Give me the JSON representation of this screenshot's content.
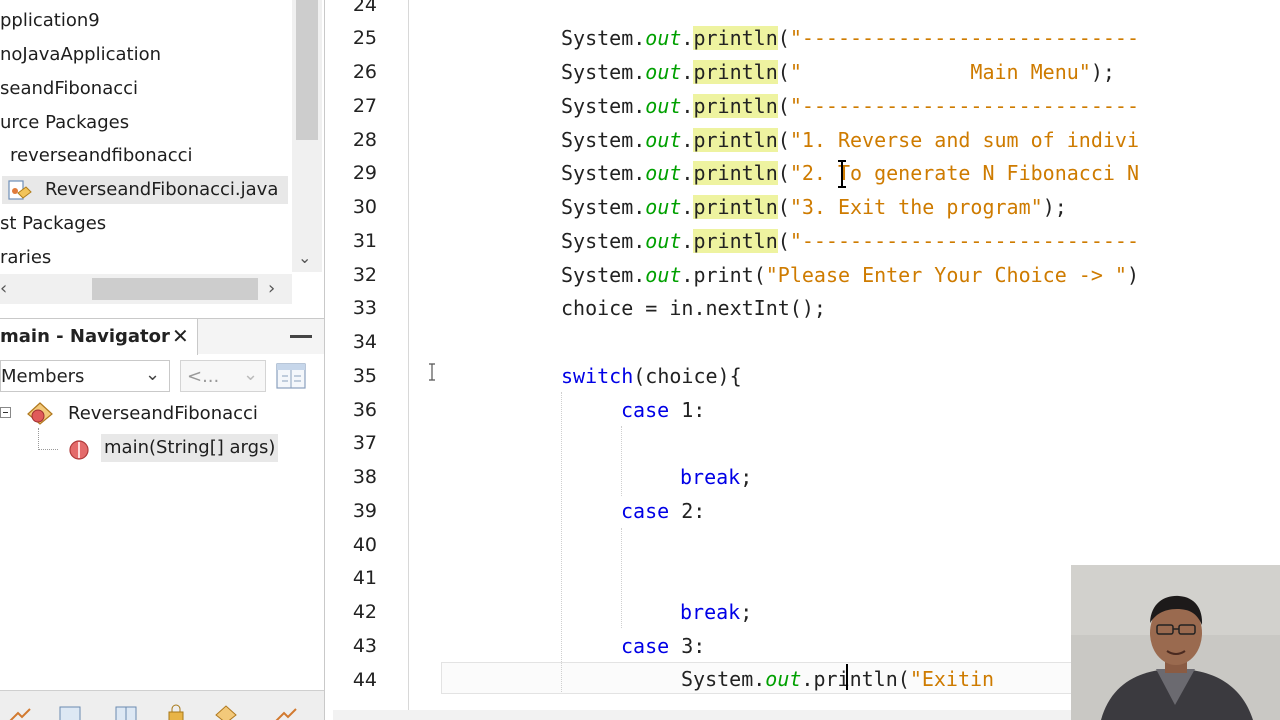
{
  "projects": {
    "items": [
      {
        "label": "pplication9"
      },
      {
        "label": "noJavaApplication"
      },
      {
        "label": "seandFibonacci"
      },
      {
        "label": "urce Packages"
      },
      {
        "label": "reverseandfibonacci"
      },
      {
        "label": "ReverseandFibonacci.java"
      },
      {
        "label": "st Packages"
      },
      {
        "label": "raries"
      }
    ]
  },
  "navigator": {
    "tab_label": "main - Navigator",
    "close_glyph": "✕",
    "members_label": "Members",
    "history_label": "<...",
    "class_label": "ReverseandFibonacci",
    "method_label": "main(String[] args)"
  },
  "editor": {
    "line_numbers": [
      "24",
      "25",
      "26",
      "27",
      "28",
      "29",
      "30",
      "31",
      "32",
      "33",
      "34",
      "35",
      "36",
      "37",
      "38",
      "39",
      "40",
      "41",
      "42",
      "43",
      "44"
    ],
    "code": {
      "sys": "System.",
      "out": "out",
      "dot": ".",
      "println": "println",
      "print": "print",
      "l25_str": "\"----------------------------",
      "l26_str": "\"              Main Menu\"",
      "l27_str": "\"----------------------------",
      "l28_str": "\"1. Reverse and sum of indivi",
      "l29_str": "\"2. To generate N Fibonacci N",
      "l30_str": "\"3. Exit the program\"",
      "l31_str": "\"----------------------------",
      "l32_str": "\"Please Enter Your Choice -> \"",
      "l33": "choice = in.nextInt();",
      "switch_kw": "switch",
      "l35_rest": "(choice){",
      "case_kw": "case",
      "case1_rest": " 1:",
      "case2_rest": " 2:",
      "case3_rest": " 3:",
      "break_kw": "break",
      "semi": ";",
      "l44_str": "\"Exitin"
    }
  },
  "icons": {
    "tree_expand": "tree-expand-icon",
    "java_file": "java-file-icon",
    "class": "class-icon",
    "method": "method-icon",
    "filter": "filter-icon"
  },
  "colors": {
    "keyword": "#0000e6",
    "string": "#ce7b00",
    "field": "#00a000",
    "method_highlight": "#eef3a0"
  }
}
